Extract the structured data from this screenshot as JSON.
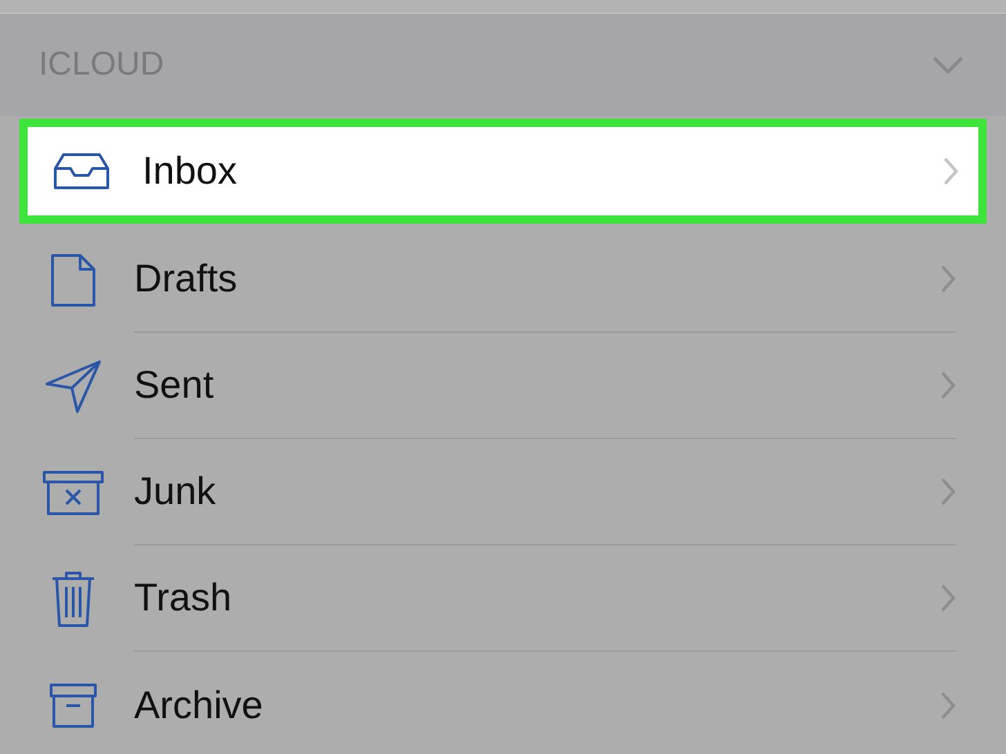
{
  "section": {
    "title": "ICLOUD",
    "expanded": true
  },
  "mailboxes": [
    {
      "kind": "inbox",
      "label": "Inbox",
      "selected": true
    },
    {
      "kind": "drafts",
      "label": "Drafts",
      "selected": false
    },
    {
      "kind": "sent",
      "label": "Sent",
      "selected": false
    },
    {
      "kind": "junk",
      "label": "Junk",
      "selected": false
    },
    {
      "kind": "trash",
      "label": "Trash",
      "selected": false
    },
    {
      "kind": "archive",
      "label": "Archive",
      "selected": false
    }
  ]
}
